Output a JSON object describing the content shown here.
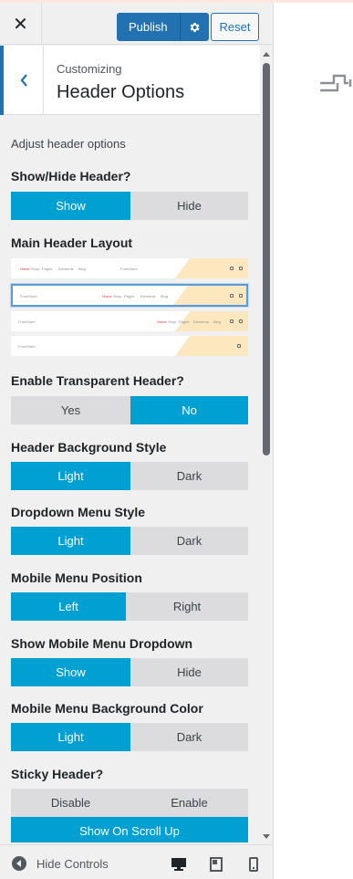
{
  "header": {
    "close_icon": "close-icon",
    "publish_label": "Publish",
    "settings_icon": "gear-icon",
    "reset_label": "Reset"
  },
  "section": {
    "breadcrumb": "Customizing",
    "title": "Header Options",
    "back_icon": "chevron-left-icon"
  },
  "description": "Adjust header options",
  "controls": [
    {
      "label": "Show/Hide Header?",
      "options": [
        "Show",
        "Hide"
      ],
      "selected": "Show"
    },
    {
      "label": "Main Header Layout",
      "layouts": 4,
      "selected_layout": 2
    },
    {
      "label": "Enable Transparent Header?",
      "options": [
        "Yes",
        "No"
      ],
      "selected": "No"
    },
    {
      "label": "Header Background Style",
      "options": [
        "Light",
        "Dark"
      ],
      "selected": "Light"
    },
    {
      "label": "Dropdown Menu Style",
      "options": [
        "Light",
        "Dark"
      ],
      "selected": "Light"
    },
    {
      "label": "Mobile Menu Position",
      "options": [
        "Left",
        "Right"
      ],
      "selected": "Left"
    },
    {
      "label": "Show Mobile Menu Dropdown",
      "options": [
        "Show",
        "Hide"
      ],
      "selected": "Show"
    },
    {
      "label": "Mobile Menu Background Color",
      "options": [
        "Light",
        "Dark"
      ],
      "selected": "Light"
    },
    {
      "label": "Sticky Header?",
      "options": [
        "Disable",
        "Enable",
        "Show On Scroll Up"
      ],
      "selected": "Show On Scroll Up"
    }
  ],
  "layout_thumbs": {
    "brand": "FurniStore",
    "nav": [
      "Home",
      "Shop",
      "Pages",
      "Elements",
      "Blog"
    ]
  },
  "footer": {
    "hide_controls_label": "Hide Controls",
    "devices": [
      "desktop-icon",
      "tablet-icon",
      "mobile-icon"
    ]
  },
  "colors": {
    "accent": "#00a0d2",
    "primary": "#2271b1",
    "inactive": "#dcdcde",
    "panel_bg": "#f0f0f1"
  }
}
